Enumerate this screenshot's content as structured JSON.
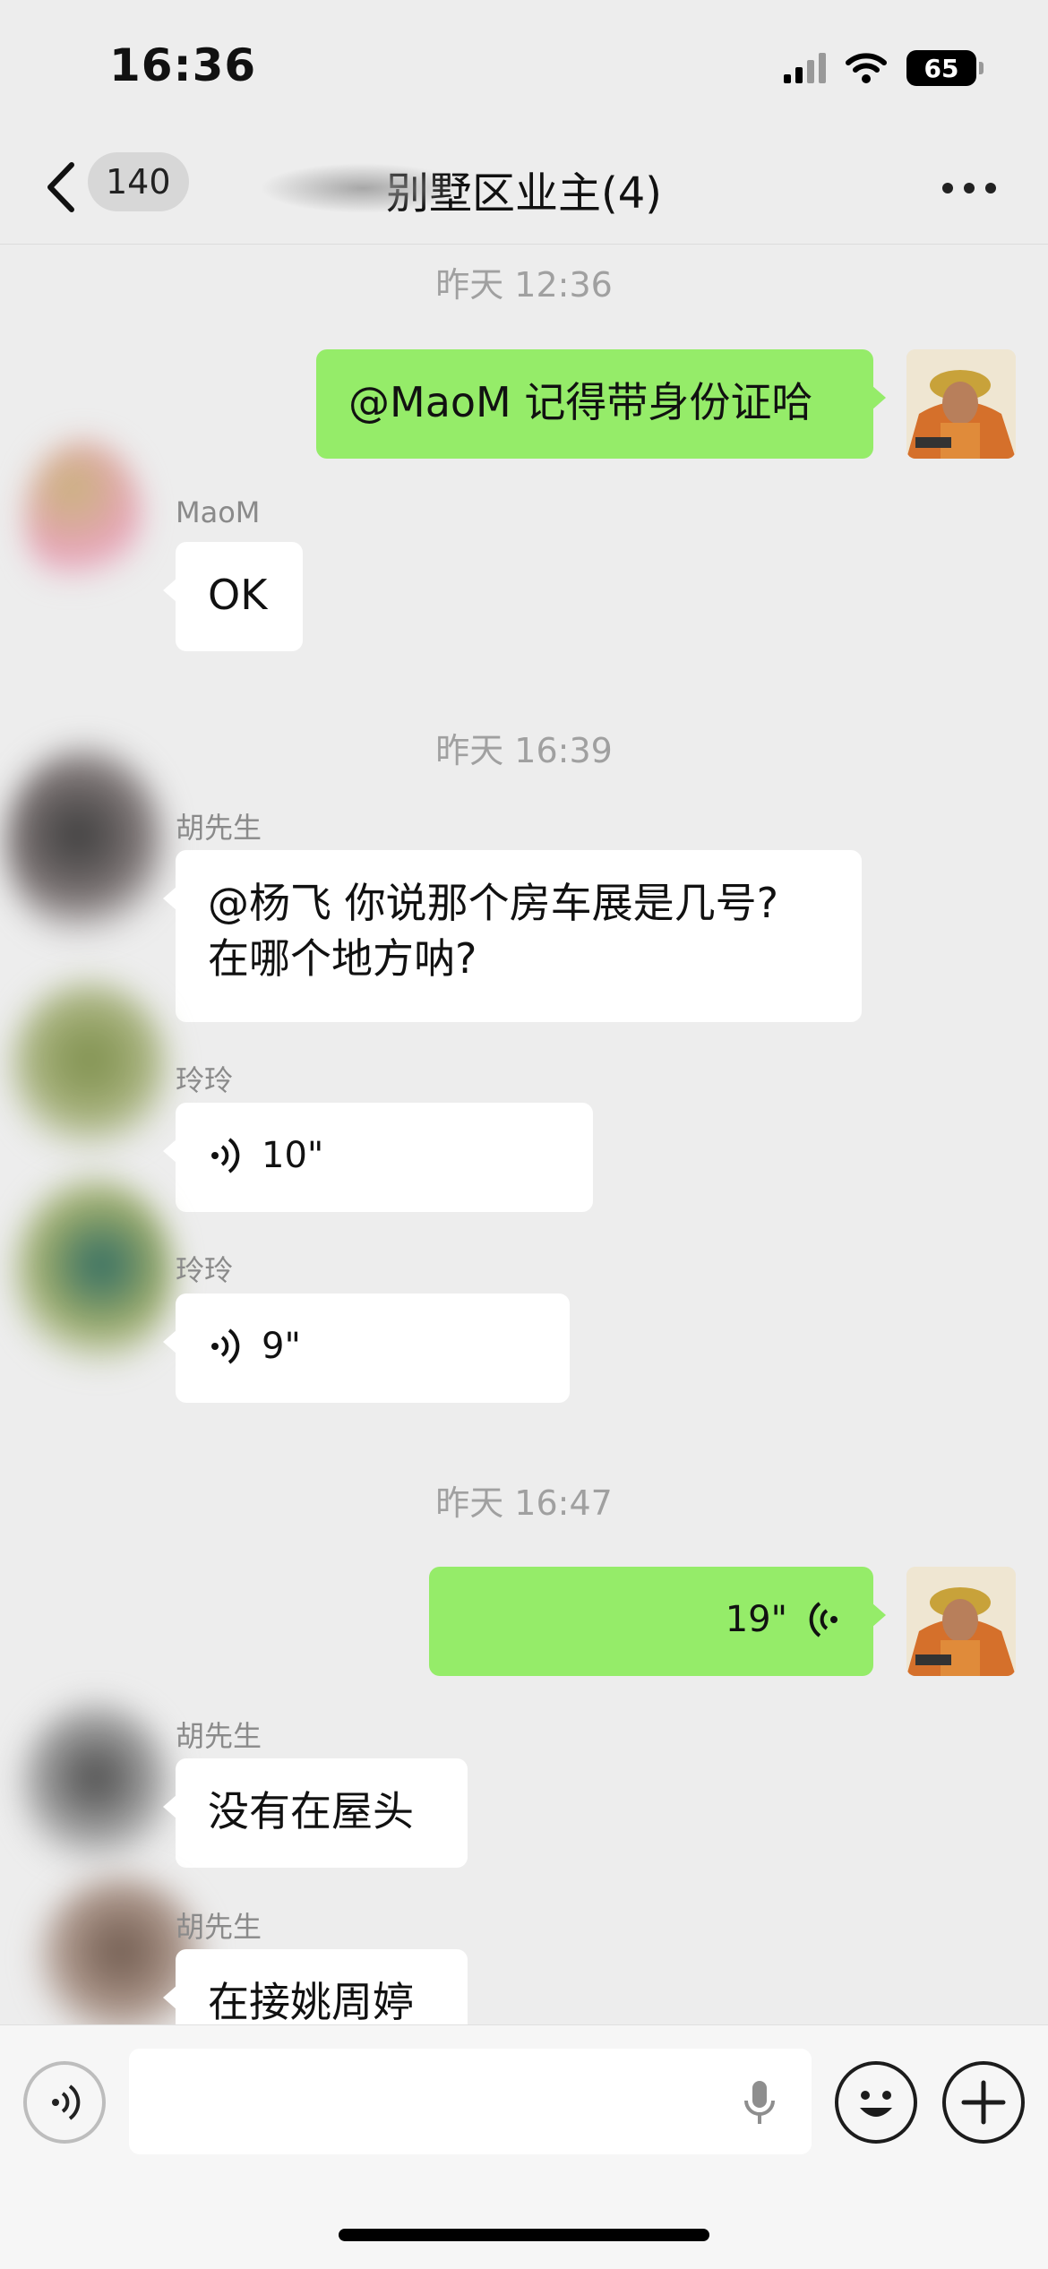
{
  "status_bar": {
    "time": "16:36",
    "battery": "65",
    "icons": [
      "signal-icon",
      "wifi-icon",
      "battery-icon"
    ]
  },
  "header": {
    "unread_count": "140",
    "title": "别墅区业主(4)",
    "back_icon": "chevron-left-icon",
    "more_icon": "more-dots-icon"
  },
  "messages": [
    {
      "type": "timestamp",
      "text": "昨天 12:36"
    },
    {
      "type": "text",
      "from": "self",
      "text": "@MaoM 记得带身份证哈"
    },
    {
      "type": "text",
      "from": "MaoM",
      "sender": "MaoM",
      "text": "OK"
    },
    {
      "type": "timestamp",
      "text": "昨天 16:39"
    },
    {
      "type": "text",
      "from": "other",
      "sender": "胡先生",
      "text_line1": "@杨飞 你说那个房车展是几号?",
      "text_line2": "在哪个地方呐?"
    },
    {
      "type": "voice",
      "from": "other",
      "sender": "玲玲",
      "duration": "10\""
    },
    {
      "type": "voice",
      "from": "other",
      "sender": "玲玲",
      "duration": "9\""
    },
    {
      "type": "timestamp",
      "text": "昨天 16:47"
    },
    {
      "type": "voice",
      "from": "self",
      "duration": "19\""
    },
    {
      "type": "text",
      "from": "other",
      "sender": "胡先生",
      "text": "没有在屋头"
    },
    {
      "type": "text",
      "from": "other",
      "sender": "胡先生",
      "text": "在接姚周婷"
    }
  ],
  "input_bar": {
    "voice_icon": "voice-mode-icon",
    "mic_icon": "microphone-icon",
    "emoji_icon": "emoji-icon",
    "plus_icon": "plus-icon"
  },
  "colors": {
    "background": "#ededed",
    "self_bubble": "#95ec69",
    "other_bubble": "#ffffff",
    "timestamp": "#a0a0a0"
  }
}
